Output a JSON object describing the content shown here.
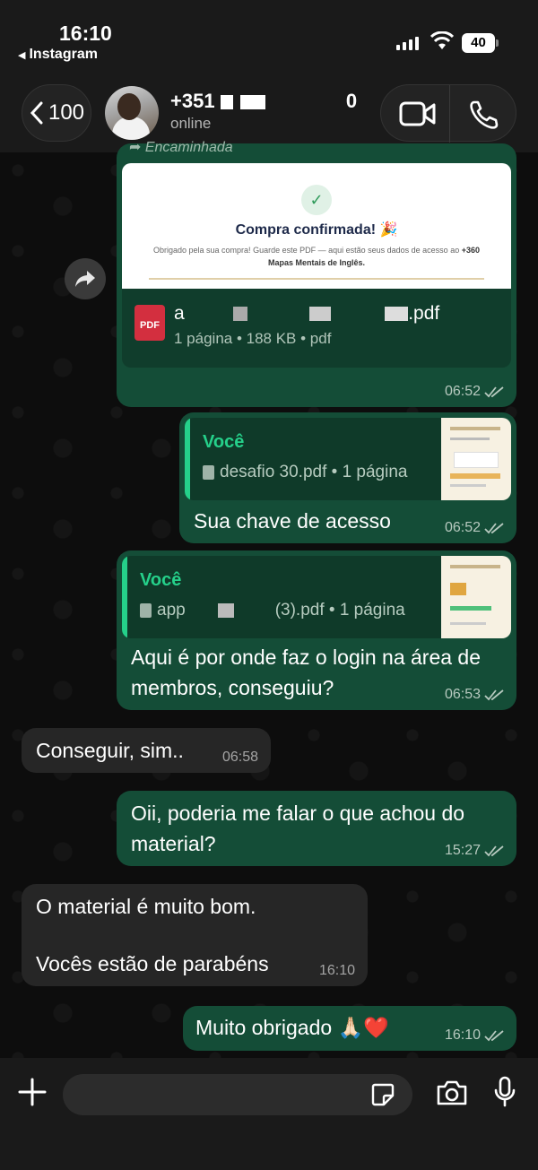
{
  "status_bar": {
    "time": "16:10",
    "back_app": "Instagram",
    "battery": "40"
  },
  "header": {
    "back_count": "100",
    "contact_name": "+351",
    "contact_name_end": "0",
    "contact_status": "online"
  },
  "messages": {
    "forwarded": {
      "label": "Encaminhada",
      "preview_title": "Compra confirmada! 🎉",
      "preview_body": "Obrigado pela sua compra! Guarde este PDF — aqui estão seus dados de acesso ao",
      "preview_body_bold": "+360 Mapas Mentais de Inglês.",
      "file_name_start": "a",
      "file_name_end": ".pdf",
      "file_info": "1 página • 188 KB • pdf",
      "pdf_badge": "PDF",
      "time": "06:52"
    },
    "reply1": {
      "author": "Você",
      "file": "desafio 30.pdf • 1 página",
      "text": "Sua chave de acesso",
      "time": "06:52"
    },
    "reply2": {
      "author": "Você",
      "file_start": "app",
      "file_end": "(3).pdf • 1 página",
      "text": "Aqui é por onde faz o login na área de membros, conseguiu?",
      "time": "06:53"
    },
    "in1": {
      "text": "Conseguir, sim..",
      "time": "06:58"
    },
    "out1": {
      "text": "Oii, poderia me falar o que achou do material?",
      "time": "15:27"
    },
    "in2": {
      "line1": "O material é muito bom.",
      "line2": "Vocês estão de parabéns",
      "time": "16:10"
    },
    "out2": {
      "text": "Muito obrigado 🙏🏻❤️",
      "time": "16:10"
    }
  },
  "composer": {
    "placeholder": ""
  },
  "icons": [
    "back-arrow-icon",
    "video-call-icon",
    "phone-icon",
    "forward-icon",
    "pdf-icon",
    "document-icon",
    "read-checks-icon",
    "plus-icon",
    "sticker-icon",
    "camera-icon",
    "microphone-icon"
  ],
  "colors": {
    "outgoing": "#144d37",
    "incoming": "#262626",
    "accent": "#25d08a"
  }
}
